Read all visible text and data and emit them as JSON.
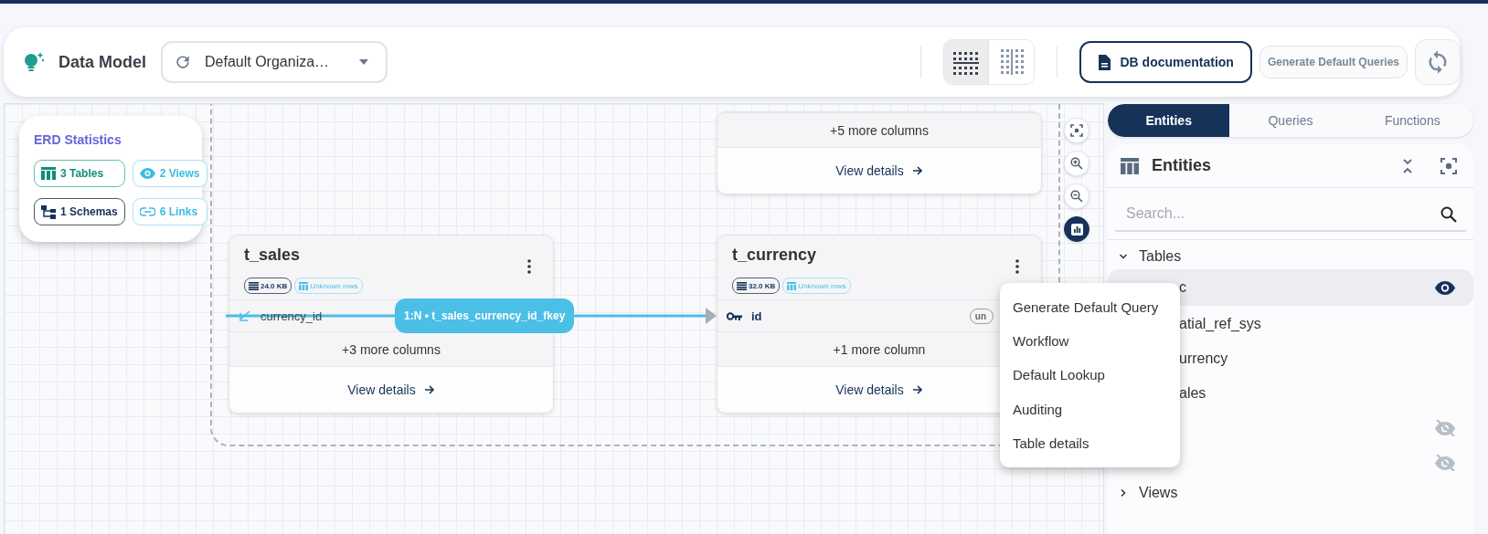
{
  "app": {
    "title": "Data Model"
  },
  "toolbar": {
    "organization": "Default Organiza…",
    "layout_modes": [
      {
        "kind": "horizontal",
        "selected": true
      },
      {
        "kind": "vertical",
        "selected": false
      }
    ],
    "buttons": [
      {
        "label": "DB documentation",
        "kind": "primary"
      },
      {
        "label": "Generate Default Queries",
        "kind": "secondary"
      }
    ]
  },
  "erd_statistics": {
    "title": "ERD Statistics",
    "chips": [
      {
        "kind": "tables",
        "label": "3 Tables"
      },
      {
        "kind": "views",
        "label": "2 Views"
      },
      {
        "kind": "schemas",
        "label": "1 Schemas"
      },
      {
        "kind": "links",
        "label": "6 Links"
      }
    ]
  },
  "tables": [
    {
      "more_columns": "+5 more columns",
      "view_details": "View details"
    },
    {
      "name": "t_sales",
      "size": "24.0 KB",
      "rows": "Unknown rows",
      "columns": [
        {
          "name": "currency_id",
          "kind": "foreign"
        }
      ],
      "more_columns": "+3 more columns",
      "view_details": "View details"
    },
    {
      "name": "t_currency",
      "size": "32.0 KB",
      "rows": "Unknown rows",
      "columns": [
        {
          "name": "id",
          "kind": "primary",
          "badge": "un"
        }
      ],
      "more_columns": "+1 more column",
      "view_details": "View details"
    }
  ],
  "relationship": {
    "label": "1:N • t_sales_currency_id_fkey"
  },
  "context_menu": {
    "items": [
      "Generate Default Query",
      "Workflow",
      "Default Lookup",
      "Auditing",
      "Table details"
    ]
  },
  "sidebar": {
    "tabs": [
      {
        "label": "Entities",
        "selected": true
      },
      {
        "label": "Queries",
        "selected": false
      },
      {
        "label": "Functions",
        "selected": false
      }
    ],
    "panel_title": "Entities",
    "search": {
      "placeholder": "Search..."
    },
    "tree": [
      {
        "label": "Tables",
        "expanded": true,
        "children": [
          {
            "label": "c",
            "selected": true,
            "eye_visible": true
          },
          {
            "label": "atial_ref_sys",
            "selected": false
          },
          {
            "label": "urrency",
            "selected": false
          },
          {
            "label": "ales",
            "selected": false
          },
          {
            "selected": false,
            "eye_visible": false
          },
          {
            "selected": false,
            "eye_visible": false
          }
        ]
      },
      {
        "label": "Views",
        "expanded": false
      }
    ]
  }
}
